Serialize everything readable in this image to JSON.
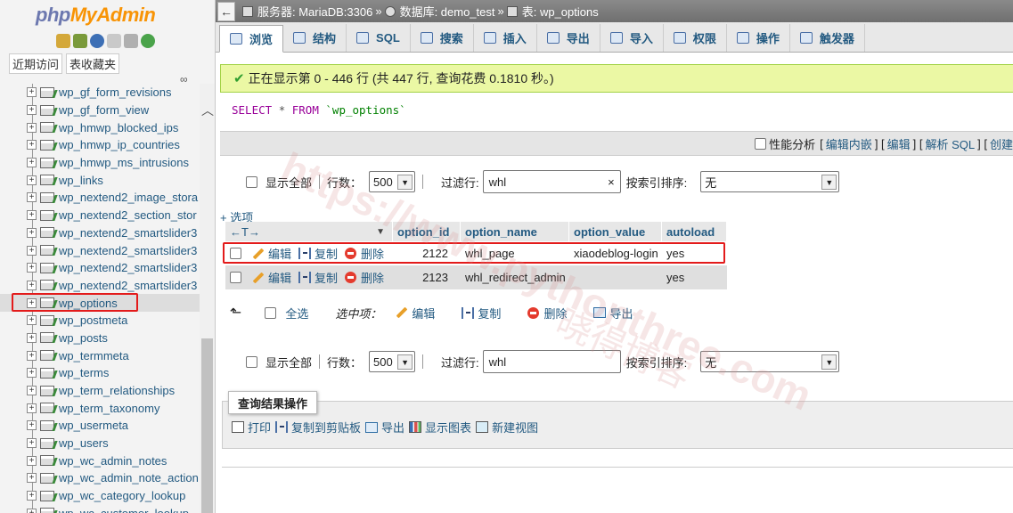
{
  "logo": {
    "php": "php",
    "myadmin": "MyAdmin"
  },
  "sidebar": {
    "tabs": [
      "近期访问",
      "表收藏夹"
    ],
    "tables": [
      "wp_gf_form_revisions",
      "wp_gf_form_view",
      "wp_hmwp_blocked_ips",
      "wp_hmwp_ip_countries",
      "wp_hmwp_ms_intrusions",
      "wp_links",
      "wp_nextend2_image_stora",
      "wp_nextend2_section_stor",
      "wp_nextend2_smartslider3",
      "wp_nextend2_smartslider3",
      "wp_nextend2_smartslider3",
      "wp_nextend2_smartslider3",
      "wp_options",
      "wp_postmeta",
      "wp_posts",
      "wp_termmeta",
      "wp_terms",
      "wp_term_relationships",
      "wp_term_taxonomy",
      "wp_usermeta",
      "wp_users",
      "wp_wc_admin_notes",
      "wp_wc_admin_note_action",
      "wp_wc_category_lookup",
      "wp_wc_customer_lookup"
    ]
  },
  "breadcrumb": {
    "server": "服务器: MariaDB:3306",
    "database": "数据库: demo_test",
    "table": "表: wp_options",
    "sep": "»"
  },
  "menu": [
    "浏览",
    "结构",
    "SQL",
    "搜索",
    "插入",
    "导出",
    "导入",
    "权限",
    "操作",
    "触发器"
  ],
  "success_message": "正在显示第 0 - 446 行 (共 447 行, 查询花费 0.1810 秒。)",
  "sql": {
    "select": "SELECT",
    "star": "*",
    "from": "FROM",
    "table": "`wp_options`"
  },
  "sql_bar": {
    "profiling": "性能分析",
    "links": [
      "编辑内嵌",
      "编辑",
      "解析 SQL",
      "创建"
    ]
  },
  "nav": {
    "show_all": "显示全部",
    "rows_label": "行数：",
    "rows_value": "500",
    "filter_label": "过滤行:",
    "filter_value": "whl",
    "filter_clear": "×",
    "sort_label": "按索引排序:",
    "sort_value": "无"
  },
  "options_link": "+ 选项",
  "table": {
    "arrows": "←T→",
    "columns": [
      "option_id",
      "option_name",
      "option_value",
      "autoload"
    ],
    "actions": {
      "edit": "编辑",
      "copy": "复制",
      "delete": "删除"
    },
    "rows": [
      {
        "option_id": "2122",
        "option_name": "whl_page",
        "option_value": "xiaodeblog-login",
        "autoload": "yes"
      },
      {
        "option_id": "2123",
        "option_name": "whl_redirect_admin",
        "option_value": "",
        "autoload": "yes"
      }
    ]
  },
  "bulk": {
    "select_all": "全选",
    "with_selected": "选中项：",
    "edit": "编辑",
    "copy": "复制",
    "delete": "删除",
    "export": "导出"
  },
  "query_ops": {
    "legend": "查询结果操作",
    "items": [
      "打印",
      "复制到剪贴板",
      "导出",
      "显示图表",
      "新建视图"
    ]
  },
  "watermark": {
    "line1": "https://www.pythonthree.com",
    "line2": "晓得博客"
  }
}
